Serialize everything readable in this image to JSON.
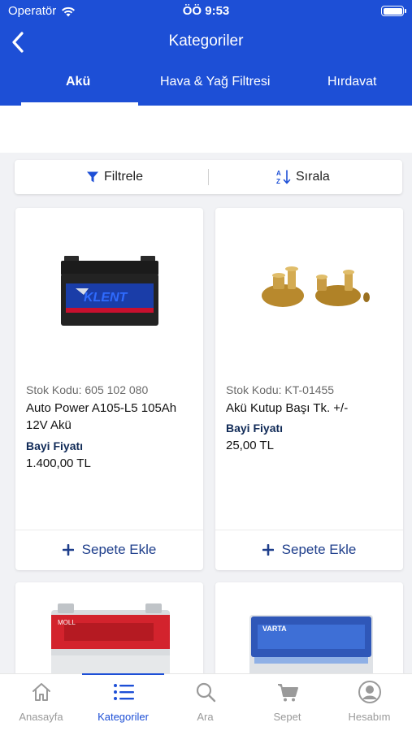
{
  "status_bar": {
    "carrier": "Operatör",
    "time": "ÖÖ 9:53"
  },
  "header": {
    "title": "Kategoriler"
  },
  "tabs": [
    {
      "label": "Akü",
      "active": true
    },
    {
      "label": "Hava & Yağ Filtresi",
      "active": false
    },
    {
      "label": "Hırdavat",
      "active": false
    }
  ],
  "toolbar": {
    "filter_label": "Filtrele",
    "sort_label": "Sırala"
  },
  "products": [
    {
      "code": "Stok Kodu: 605 102 080",
      "name": "Auto Power A105-L5 105Ah 12V Akü",
      "price_label": "Bayi Fiyatı",
      "price": "1.400,00 TL",
      "cart_label": "Sepete Ekle",
      "image": "car-battery"
    },
    {
      "code": "Stok Kodu: KT-01455",
      "name": "Akü Kutup Başı Tk. +/-",
      "price_label": "Bayi Fiyatı",
      "price": "25,00 TL",
      "cart_label": "Sepete Ekle",
      "image": "battery-terminals"
    }
  ],
  "bottom_nav": [
    {
      "label": "Anasayfa",
      "icon": "home-icon",
      "active": false
    },
    {
      "label": "Kategoriler",
      "icon": "list-icon",
      "active": true
    },
    {
      "label": "Ara",
      "icon": "search-icon",
      "active": false
    },
    {
      "label": "Sepet",
      "icon": "cart-icon",
      "active": false
    },
    {
      "label": "Hesabım",
      "icon": "account-icon",
      "active": false
    }
  ],
  "colors": {
    "primary": "#1d4fd6",
    "cart_text": "#1f3f8c",
    "price_label": "#102a57"
  }
}
